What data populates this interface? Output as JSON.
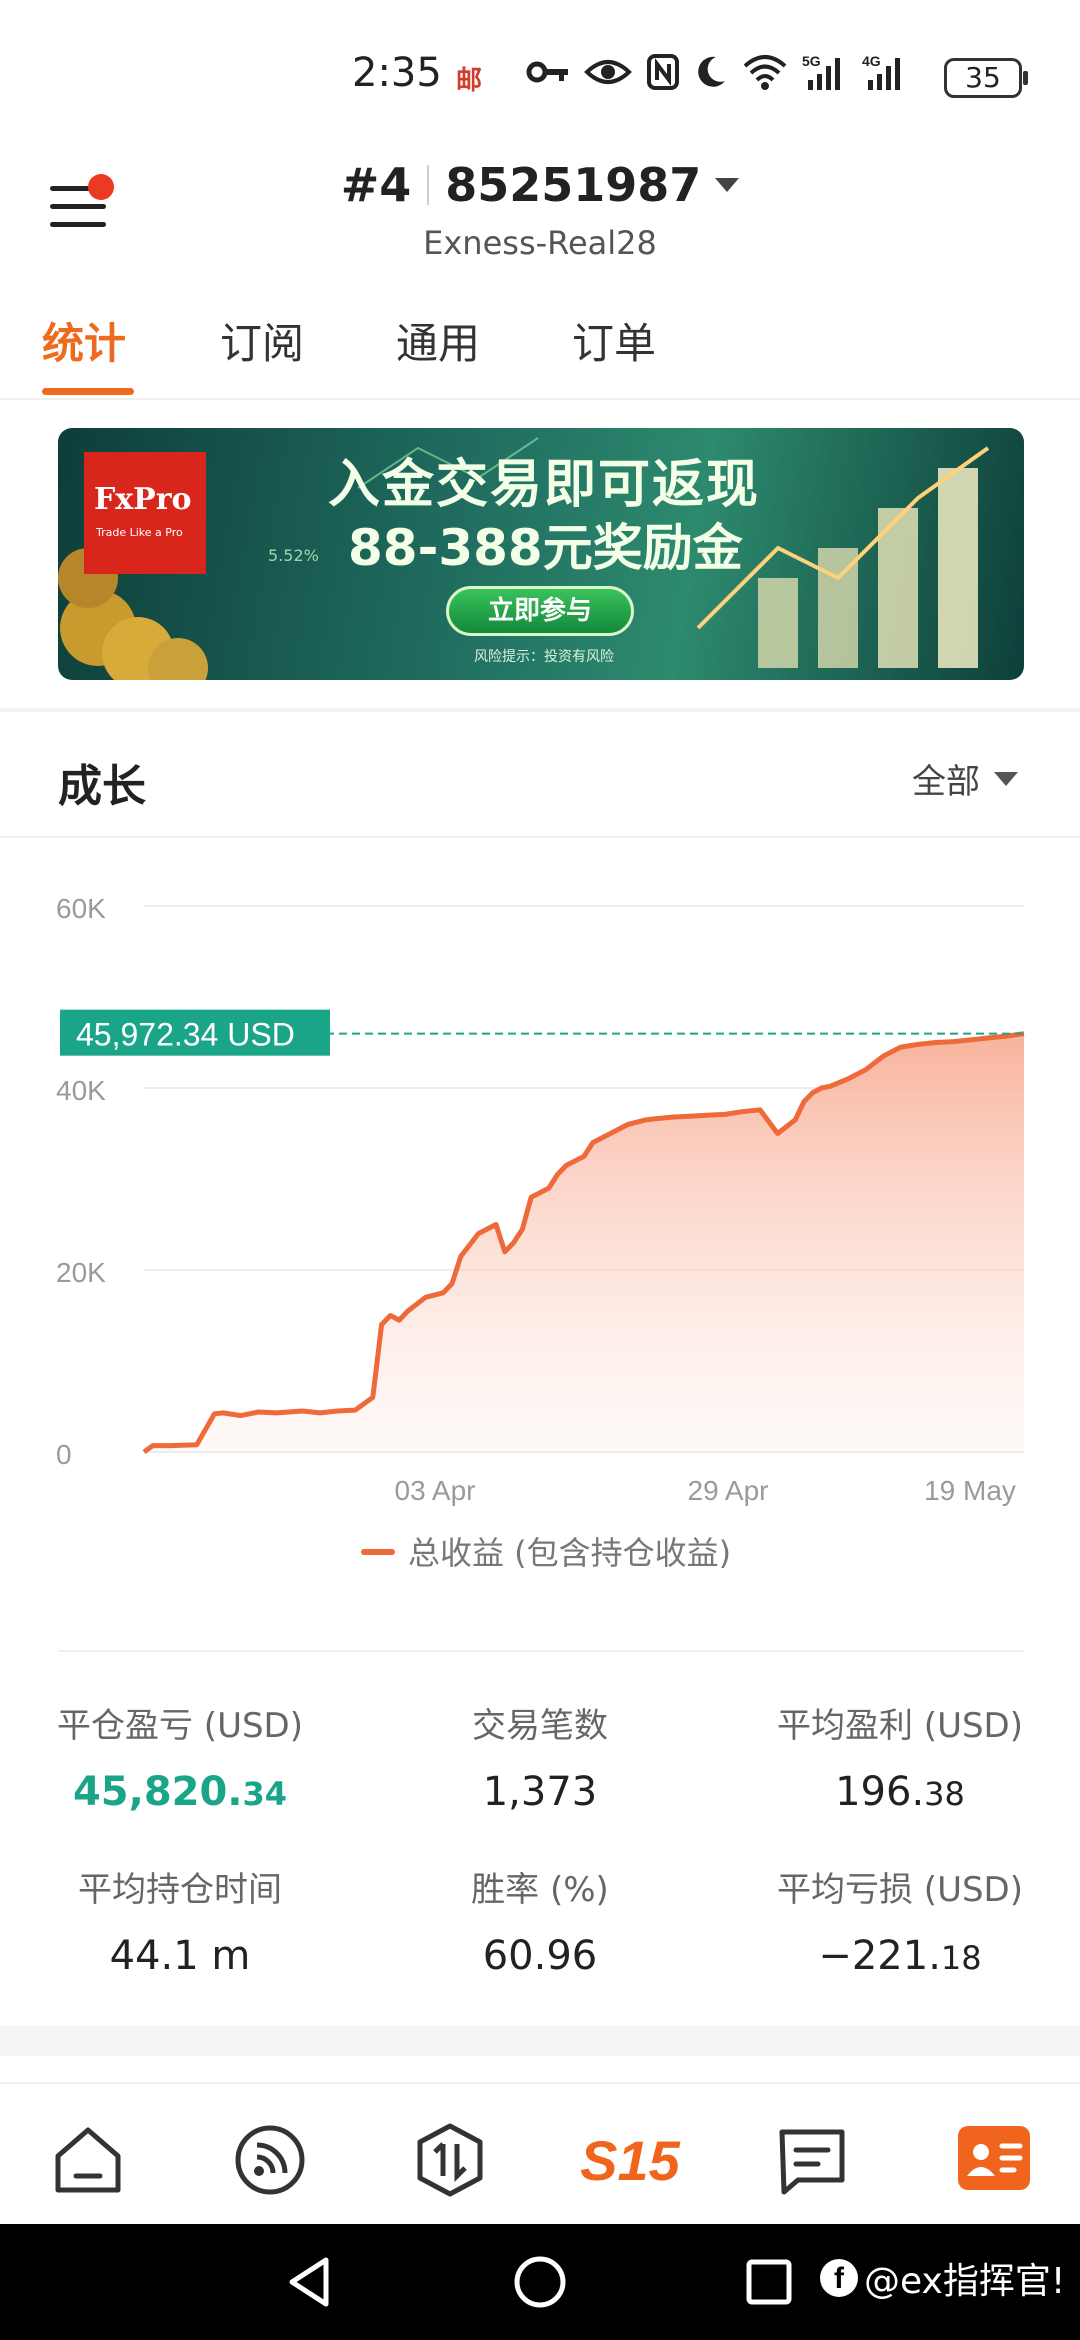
{
  "status_bar": {
    "time": "2:35",
    "mail_badge": "邮",
    "battery": "35",
    "icons": [
      "key-icon",
      "eye-icon",
      "nfc-icon",
      "moon-icon",
      "wifi-icon",
      "signal-5g-icon",
      "signal-4g-icon",
      "battery-icon"
    ],
    "signal_labels": [
      "5G",
      "4G"
    ]
  },
  "header": {
    "account_index": "#4",
    "account_number": "85251987",
    "server": "Exness-Real28",
    "menu_has_badge": true,
    "badge_color": "#ec3a22"
  },
  "tabs": [
    {
      "label": "统计",
      "active": true
    },
    {
      "label": "订阅",
      "active": false
    },
    {
      "label": "通用",
      "active": false
    },
    {
      "label": "订单",
      "active": false
    }
  ],
  "banner": {
    "logo_text": "FxPro",
    "logo_tagline": "Trade Like a Pro",
    "percent": "5.52%",
    "title_line1": "入金交易即可返现",
    "title_line2": "88-388元奖励金",
    "button": "立即参与",
    "risk_note": "风险提示：投资有风险"
  },
  "growth": {
    "title": "成长",
    "range_selector": "全部"
  },
  "chart_data": {
    "type": "area",
    "accent_color": "#ee6a3a",
    "reference_color": "#1aa589",
    "current_value_label": "45,972.34 USD",
    "current_value": 45972.34,
    "y_ticks": [
      "60K",
      "40K",
      "20K",
      "0"
    ],
    "ylim": [
      0,
      60000
    ],
    "x_ticks": [
      "03 Apr",
      "29 Apr",
      "19 May"
    ],
    "legend": "总收益 (包含持仓收益)",
    "grid": true,
    "series": [
      {
        "name": "总收益 (包含持仓收益)",
        "x": [
          0,
          0.01,
          0.03,
          0.06,
          0.08,
          0.09,
          0.11,
          0.13,
          0.15,
          0.18,
          0.2,
          0.22,
          0.24,
          0.26,
          0.27,
          0.28,
          0.29,
          0.3,
          0.32,
          0.34,
          0.35,
          0.36,
          0.38,
          0.4,
          0.41,
          0.42,
          0.43,
          0.44,
          0.45,
          0.46,
          0.47,
          0.48,
          0.5,
          0.51,
          0.53,
          0.55,
          0.57,
          0.58,
          0.6,
          0.62,
          0.64,
          0.66,
          0.68,
          0.7,
          0.72,
          0.74,
          0.75,
          0.76,
          0.77,
          0.78,
          0.8,
          0.82,
          0.84,
          0.86,
          0.88,
          0.9,
          0.92,
          0.94,
          0.96,
          0.98,
          1.0
        ],
        "y": [
          0,
          700,
          700,
          800,
          4200,
          4300,
          4000,
          4400,
          4300,
          4500,
          4300,
          4500,
          4600,
          6000,
          14000,
          15000,
          14500,
          15500,
          17000,
          17500,
          18500,
          21500,
          24000,
          25000,
          22000,
          23000,
          24500,
          28000,
          28500,
          29000,
          30500,
          31500,
          32500,
          34000,
          35000,
          36000,
          36500,
          36600,
          36800,
          36900,
          37000,
          37100,
          37400,
          37600,
          35000,
          36500,
          38500,
          39500,
          40000,
          40200,
          41000,
          42000,
          43500,
          44500,
          44800,
          45000,
          45100,
          45300,
          45500,
          45700,
          45972
        ]
      }
    ]
  },
  "stats": [
    {
      "label": "平仓盈亏 (USD)",
      "int": "45,820.",
      "frac": "34",
      "highlight": true
    },
    {
      "label": "交易笔数",
      "int": "1,373",
      "frac": "",
      "highlight": false
    },
    {
      "label": "平均盈利 (USD)",
      "int": "196.",
      "frac": "38",
      "highlight": false
    },
    {
      "label": "平均持仓时间",
      "int": "44.1 m",
      "frac": "",
      "highlight": false
    },
    {
      "label": "胜率 (%)",
      "int": "60.96",
      "frac": "",
      "highlight": false
    },
    {
      "label": "平均亏损 (USD)",
      "int": "−221.",
      "frac": "18",
      "highlight": false
    }
  ],
  "bottom_nav": {
    "items": [
      "home-icon",
      "feed-icon",
      "trade-icon",
      "s15-icon",
      "message-icon",
      "profile-icon"
    ],
    "s15_label": "S15",
    "accent": "#f0641e"
  },
  "system_nav": {
    "watermark": "@ex指挥官!",
    "fb_glyph": "f"
  }
}
